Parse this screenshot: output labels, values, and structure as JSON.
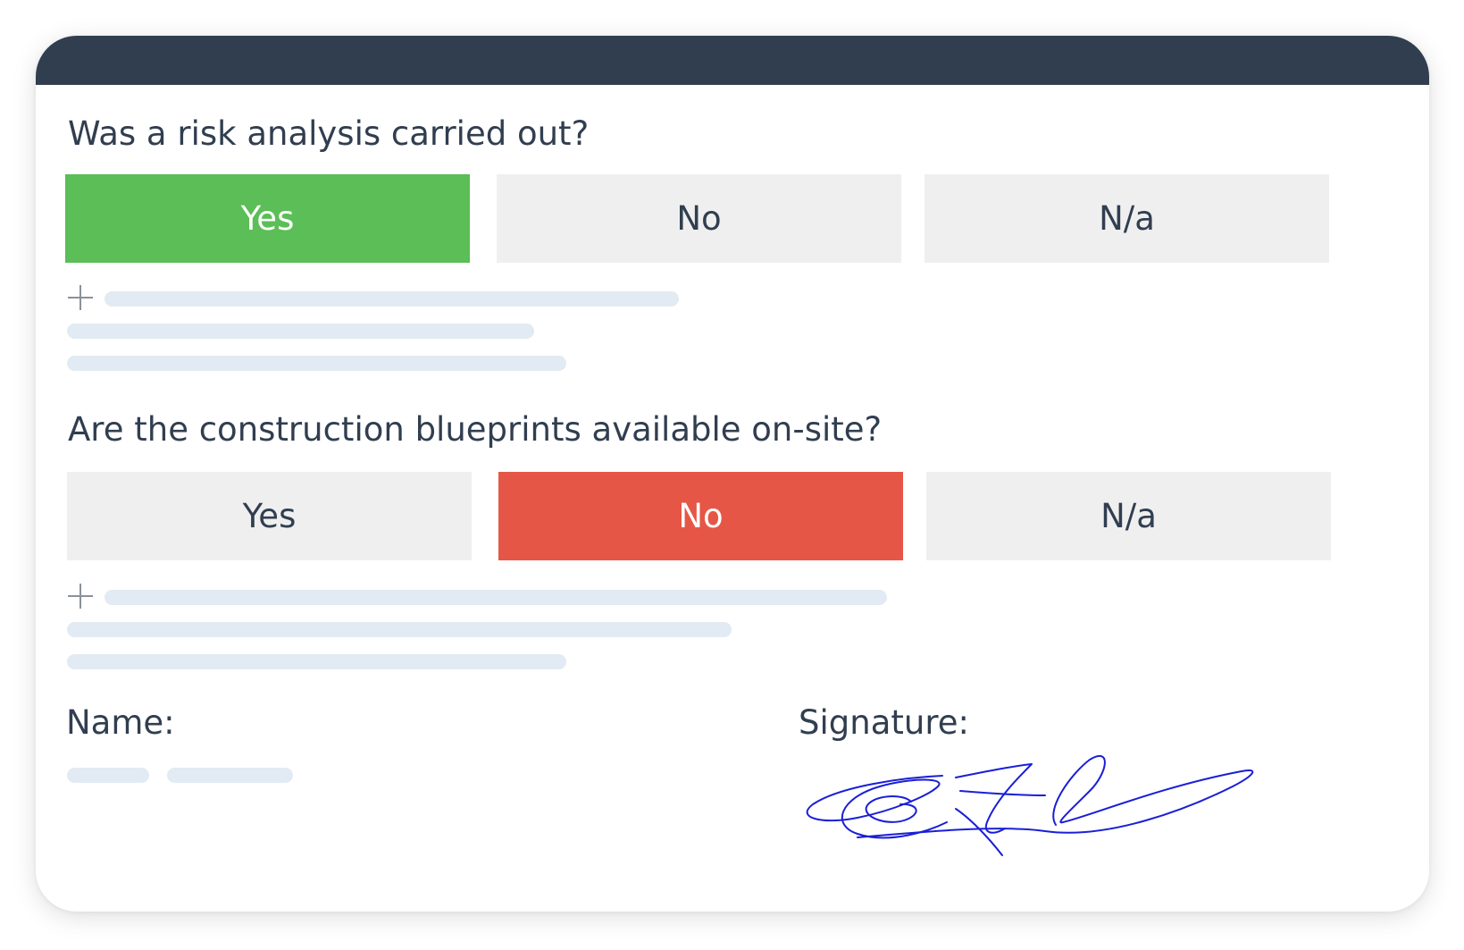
{
  "colors": {
    "header_bar": "#313e50",
    "text": "#313e50",
    "selected_yes": "#5bbe56",
    "selected_no": "#e65646",
    "unselected": "#efefef",
    "placeholder_line": "#e2eaf3",
    "signature_ink": "#1a1fd6"
  },
  "questions": [
    {
      "text": "Was a risk analysis carried out?",
      "options": [
        {
          "label": "Yes",
          "selected": true
        },
        {
          "label": "No",
          "selected": false
        },
        {
          "label": "N/a",
          "selected": false
        }
      ]
    },
    {
      "text": "Are the construction blueprints available on-site?",
      "options": [
        {
          "label": "Yes",
          "selected": false
        },
        {
          "label": "No",
          "selected": true
        },
        {
          "label": "N/a",
          "selected": false
        }
      ]
    }
  ],
  "footer": {
    "name_label": "Name:",
    "signature_label": "Signature:"
  }
}
